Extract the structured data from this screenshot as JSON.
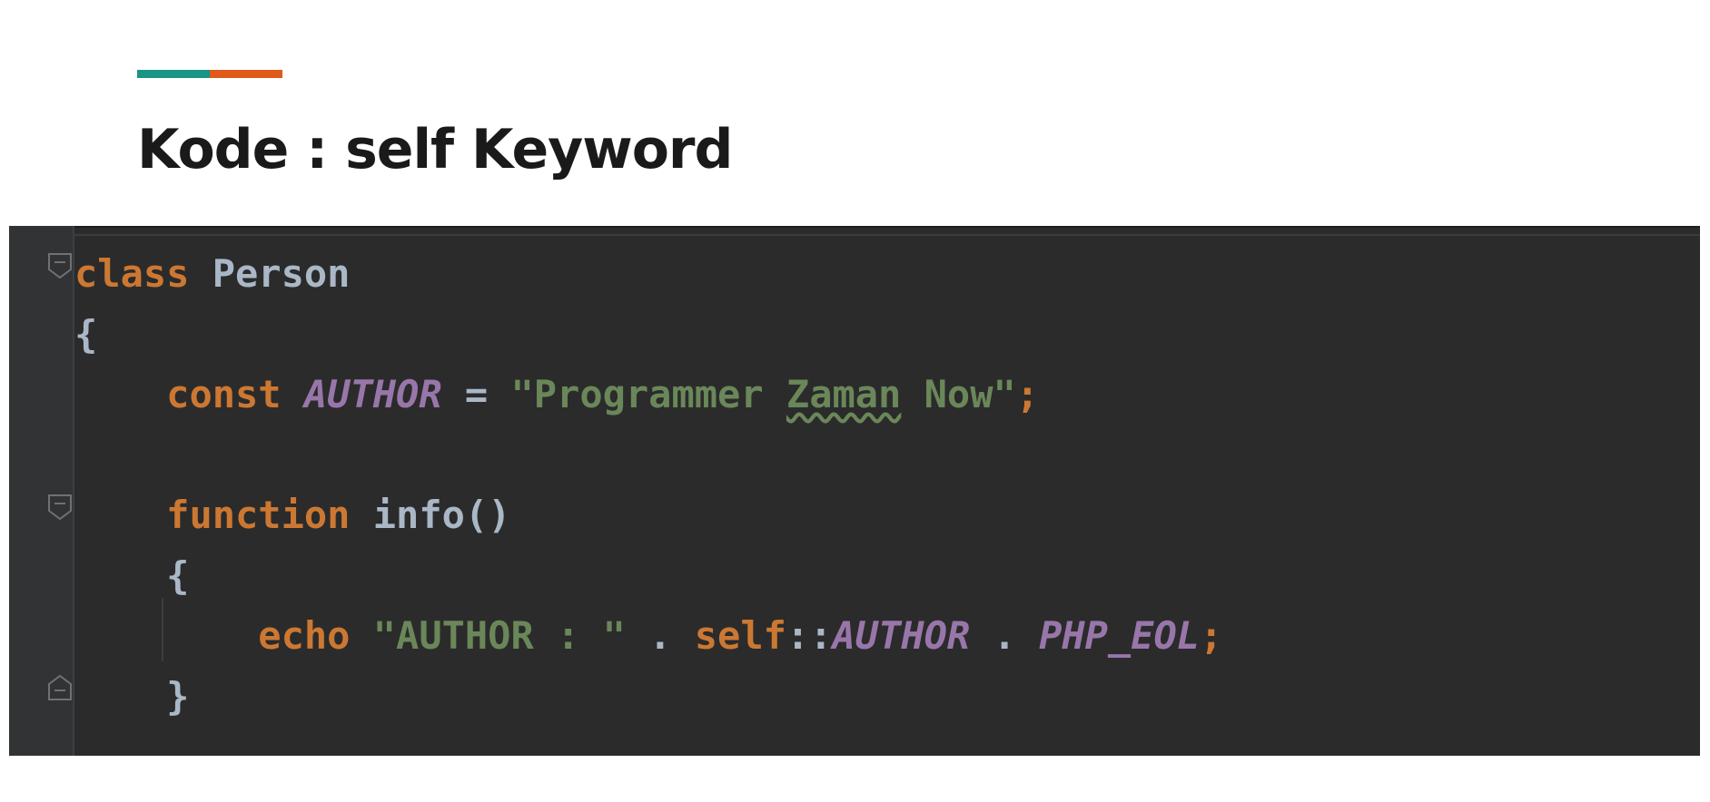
{
  "slide": {
    "title": "Kode : self Keyword",
    "accent_colors": [
      "#1a9487",
      "#e05a1a"
    ]
  },
  "editor": {
    "colors": {
      "background": "#2b2b2b",
      "gutter": "#313335",
      "keyword": "#cc7832",
      "constant": "#9876aa",
      "string": "#6a8759",
      "default": "#a9b7c6"
    },
    "lines": [
      {
        "tokens": [
          {
            "text": "class",
            "type": "kw"
          },
          {
            "text": " ",
            "type": "plain"
          },
          {
            "text": "Person",
            "type": "cls"
          }
        ]
      },
      {
        "tokens": [
          {
            "text": "{",
            "type": "plain"
          }
        ]
      },
      {
        "tokens": [
          {
            "text": "    ",
            "type": "plain"
          },
          {
            "text": "const",
            "type": "kw"
          },
          {
            "text": " ",
            "type": "plain"
          },
          {
            "text": "AUTHOR",
            "type": "const"
          },
          {
            "text": " = ",
            "type": "plain"
          },
          {
            "text": "\"Programmer ",
            "type": "str"
          },
          {
            "text": "Zaman",
            "type": "str-squiggle"
          },
          {
            "text": " Now\"",
            "type": "str"
          },
          {
            "text": ";",
            "type": "kw"
          }
        ]
      },
      {
        "tokens": []
      },
      {
        "tokens": [
          {
            "text": "    ",
            "type": "plain"
          },
          {
            "text": "function",
            "type": "kw"
          },
          {
            "text": " ",
            "type": "plain"
          },
          {
            "text": "info",
            "type": "fn"
          },
          {
            "text": "()",
            "type": "plain"
          }
        ]
      },
      {
        "tokens": [
          {
            "text": "    ",
            "type": "plain"
          },
          {
            "text": "{",
            "type": "plain"
          }
        ]
      },
      {
        "tokens": [
          {
            "text": "        ",
            "type": "plain"
          },
          {
            "text": "echo",
            "type": "kw"
          },
          {
            "text": " ",
            "type": "plain"
          },
          {
            "text": "\"AUTHOR : \"",
            "type": "str"
          },
          {
            "text": " . ",
            "type": "plain"
          },
          {
            "text": "self",
            "type": "kw"
          },
          {
            "text": "::",
            "type": "plain"
          },
          {
            "text": "AUTHOR",
            "type": "const"
          },
          {
            "text": " . ",
            "type": "plain"
          },
          {
            "text": "PHP_EOL",
            "type": "const"
          },
          {
            "text": ";",
            "type": "kw"
          }
        ]
      },
      {
        "tokens": [
          {
            "text": "    ",
            "type": "plain"
          },
          {
            "text": "}",
            "type": "plain"
          }
        ]
      }
    ],
    "fold_markers": [
      {
        "line": 0,
        "kind": "fold-open-icon"
      },
      {
        "line": 4,
        "kind": "fold-open-icon"
      },
      {
        "line": 7,
        "kind": "fold-close-icon"
      }
    ]
  }
}
